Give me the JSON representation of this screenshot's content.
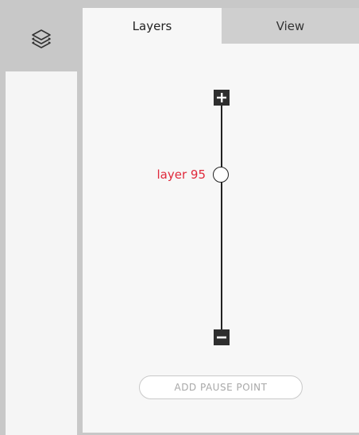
{
  "sidebar": {
    "icon": "layers-icon"
  },
  "tabs": [
    {
      "label": "Layers",
      "active": true
    },
    {
      "label": "View",
      "active": false
    }
  ],
  "slider": {
    "current_label": "layer 95",
    "label_color": "#e0293b",
    "plus_icon": "plus-icon",
    "minus_icon": "minus-icon"
  },
  "actions": {
    "add_pause_point": "ADD PAUSE POINT"
  }
}
